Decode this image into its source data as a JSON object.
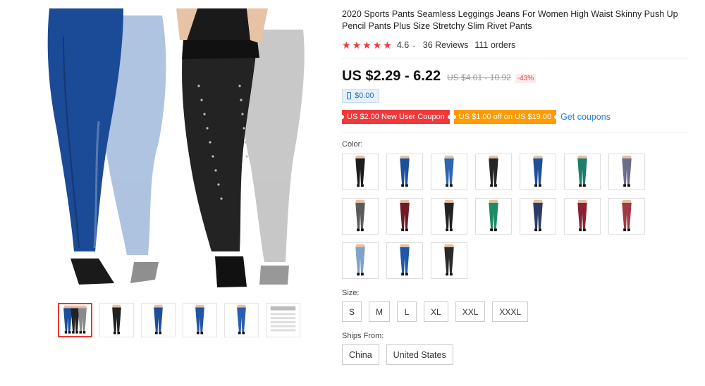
{
  "product": {
    "title": "2020 Sports Pants Seamless Leggings Jeans For Women High Waist Skinny Push Up Pencil Pants Plus Size Stretchy Slim Rivet Pants"
  },
  "rating": {
    "stars": 5,
    "value": "4.6",
    "chevron": "⌄",
    "reviews": "36 Reviews",
    "orders": "111 orders"
  },
  "price": {
    "current": "US $2.29 - 6.22",
    "original": "US $4.01 - 10.92",
    "discount": "-43%",
    "app_price": "$0.00"
  },
  "coupons": {
    "new_user": "US $2.00 New User Coupon",
    "store": "US $1.00 off on US $19.00",
    "get_label": "Get coupons"
  },
  "colors": {
    "label": "Color:",
    "swatches": [
      {
        "name": "black",
        "hex": "#1c1c1c"
      },
      {
        "name": "blue",
        "hex": "#1e4f9a"
      },
      {
        "name": "blue-light",
        "hex": "#2f66b3"
      },
      {
        "name": "black-2",
        "hex": "#262626"
      },
      {
        "name": "blue-2",
        "hex": "#204f98"
      },
      {
        "name": "green",
        "hex": "#1d7d6b"
      },
      {
        "name": "purple-gray",
        "hex": "#6c6d8c"
      },
      {
        "name": "gray-print",
        "hex": "#5b5b5b"
      },
      {
        "name": "burgundy",
        "hex": "#6f1b25"
      },
      {
        "name": "black-3",
        "hex": "#222222"
      },
      {
        "name": "green-2",
        "hex": "#1f8a68"
      },
      {
        "name": "navy",
        "hex": "#2a3b66"
      },
      {
        "name": "wine",
        "hex": "#8a2232"
      },
      {
        "name": "red-wine",
        "hex": "#a03a44"
      },
      {
        "name": "light-blue",
        "hex": "#7fa3c9"
      },
      {
        "name": "blue-3",
        "hex": "#1f58a8"
      },
      {
        "name": "black-4",
        "hex": "#2a2a2a"
      }
    ]
  },
  "sizes": {
    "label": "Size:",
    "options": [
      "S",
      "M",
      "L",
      "XL",
      "XXL",
      "XXXL"
    ]
  },
  "ships": {
    "label": "Ships From:",
    "options": [
      "China",
      "United States"
    ]
  },
  "gallery": {
    "thumbnails": [
      {
        "name": "thumb-multi",
        "colors": [
          "#1e4f9a",
          "#222222",
          "#8a8a8a"
        ]
      },
      {
        "name": "thumb-black",
        "colors": [
          "#222222"
        ]
      },
      {
        "name": "thumb-blue",
        "colors": [
          "#1e4f9a"
        ]
      },
      {
        "name": "thumb-blue-2",
        "colors": [
          "#1e55a5"
        ]
      },
      {
        "name": "thumb-blue-3",
        "colors": [
          "#2a5fb0"
        ]
      },
      {
        "name": "thumb-size-chart",
        "colors": [
          "#cccccc"
        ]
      }
    ]
  }
}
